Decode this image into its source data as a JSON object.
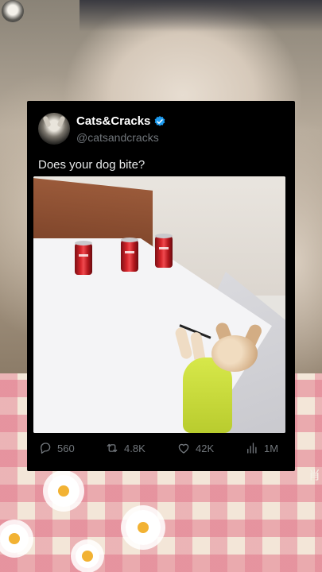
{
  "tweet": {
    "display_name": "Cats&Cracks",
    "handle": "@catsandcracks",
    "verified": true,
    "text": "Does your dog bite?",
    "accent_color": "#1d9bf0"
  },
  "stats": {
    "replies": "560",
    "retweets": "4.8K",
    "likes": "42K",
    "views": "1M"
  },
  "overlay": {
    "watermark": "肖"
  },
  "icons": {
    "verified": "verified-badge-icon",
    "replies": "reply-bubble-icon",
    "retweets": "retweet-icon",
    "likes": "heart-icon",
    "views": "views-bars-icon"
  }
}
